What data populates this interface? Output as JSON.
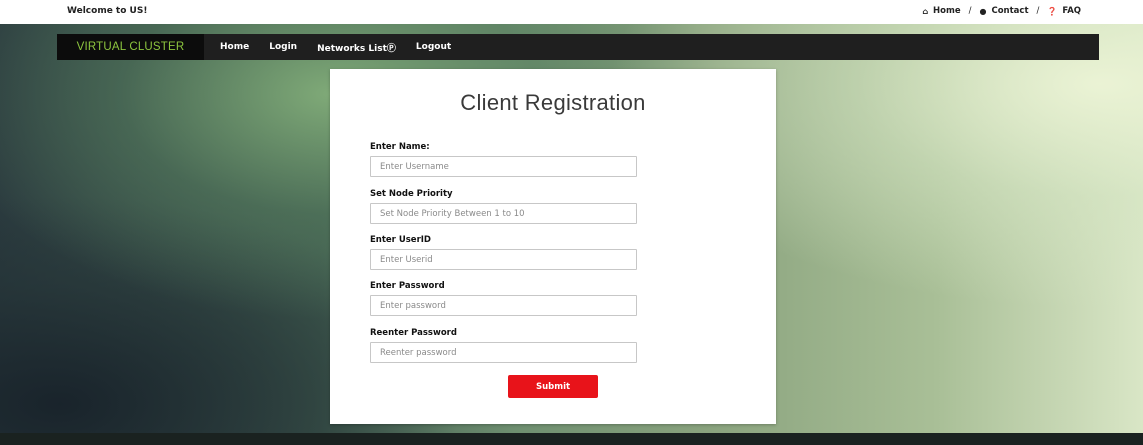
{
  "topbar": {
    "welcome": "Welcome to US!",
    "links": [
      {
        "label": "Home",
        "icon": "home-icon"
      },
      {
        "label": "Contact",
        "icon": "chat-icon"
      },
      {
        "label": "FAQ",
        "icon": "question-icon"
      }
    ],
    "separator": "/"
  },
  "navbar": {
    "brand": "VIRTUAL CLUSTER",
    "items": [
      "Home",
      "Login",
      "Networks List",
      "Logout"
    ],
    "networks_suffix_icon": "circle-arrow-icon"
  },
  "form": {
    "title": "Client Registration",
    "fields": [
      {
        "label": "Enter Name:",
        "placeholder": "Enter Username",
        "value": ""
      },
      {
        "label": "Set Node Priority",
        "placeholder": "Set Node Priority Between 1 to 10",
        "value": ""
      },
      {
        "label": "Enter UserID",
        "placeholder": "Enter Userid",
        "value": ""
      },
      {
        "label": "Enter Password",
        "placeholder": "Enter password",
        "value": ""
      },
      {
        "label": "Reenter Password",
        "placeholder": "Reenter password",
        "value": ""
      }
    ],
    "submit_label": "Submit"
  },
  "colors": {
    "brand_text": "#8dc63f",
    "navbar_bg": "#1f1f1f",
    "submit_bg": "#e8131a"
  }
}
